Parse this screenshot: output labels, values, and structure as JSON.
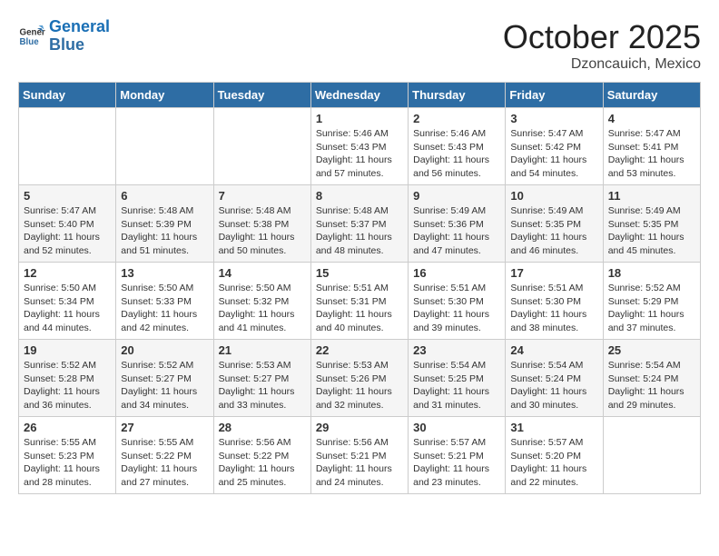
{
  "header": {
    "logo_line1": "General",
    "logo_line2": "Blue",
    "month": "October 2025",
    "location": "Dzoncauich, Mexico"
  },
  "weekdays": [
    "Sunday",
    "Monday",
    "Tuesday",
    "Wednesday",
    "Thursday",
    "Friday",
    "Saturday"
  ],
  "weeks": [
    [
      {
        "day": "",
        "sunrise": "",
        "sunset": "",
        "daylight": ""
      },
      {
        "day": "",
        "sunrise": "",
        "sunset": "",
        "daylight": ""
      },
      {
        "day": "",
        "sunrise": "",
        "sunset": "",
        "daylight": ""
      },
      {
        "day": "1",
        "sunrise": "Sunrise: 5:46 AM",
        "sunset": "Sunset: 5:43 PM",
        "daylight": "Daylight: 11 hours and 57 minutes."
      },
      {
        "day": "2",
        "sunrise": "Sunrise: 5:46 AM",
        "sunset": "Sunset: 5:43 PM",
        "daylight": "Daylight: 11 hours and 56 minutes."
      },
      {
        "day": "3",
        "sunrise": "Sunrise: 5:47 AM",
        "sunset": "Sunset: 5:42 PM",
        "daylight": "Daylight: 11 hours and 54 minutes."
      },
      {
        "day": "4",
        "sunrise": "Sunrise: 5:47 AM",
        "sunset": "Sunset: 5:41 PM",
        "daylight": "Daylight: 11 hours and 53 minutes."
      }
    ],
    [
      {
        "day": "5",
        "sunrise": "Sunrise: 5:47 AM",
        "sunset": "Sunset: 5:40 PM",
        "daylight": "Daylight: 11 hours and 52 minutes."
      },
      {
        "day": "6",
        "sunrise": "Sunrise: 5:48 AM",
        "sunset": "Sunset: 5:39 PM",
        "daylight": "Daylight: 11 hours and 51 minutes."
      },
      {
        "day": "7",
        "sunrise": "Sunrise: 5:48 AM",
        "sunset": "Sunset: 5:38 PM",
        "daylight": "Daylight: 11 hours and 50 minutes."
      },
      {
        "day": "8",
        "sunrise": "Sunrise: 5:48 AM",
        "sunset": "Sunset: 5:37 PM",
        "daylight": "Daylight: 11 hours and 48 minutes."
      },
      {
        "day": "9",
        "sunrise": "Sunrise: 5:49 AM",
        "sunset": "Sunset: 5:36 PM",
        "daylight": "Daylight: 11 hours and 47 minutes."
      },
      {
        "day": "10",
        "sunrise": "Sunrise: 5:49 AM",
        "sunset": "Sunset: 5:35 PM",
        "daylight": "Daylight: 11 hours and 46 minutes."
      },
      {
        "day": "11",
        "sunrise": "Sunrise: 5:49 AM",
        "sunset": "Sunset: 5:35 PM",
        "daylight": "Daylight: 11 hours and 45 minutes."
      }
    ],
    [
      {
        "day": "12",
        "sunrise": "Sunrise: 5:50 AM",
        "sunset": "Sunset: 5:34 PM",
        "daylight": "Daylight: 11 hours and 44 minutes."
      },
      {
        "day": "13",
        "sunrise": "Sunrise: 5:50 AM",
        "sunset": "Sunset: 5:33 PM",
        "daylight": "Daylight: 11 hours and 42 minutes."
      },
      {
        "day": "14",
        "sunrise": "Sunrise: 5:50 AM",
        "sunset": "Sunset: 5:32 PM",
        "daylight": "Daylight: 11 hours and 41 minutes."
      },
      {
        "day": "15",
        "sunrise": "Sunrise: 5:51 AM",
        "sunset": "Sunset: 5:31 PM",
        "daylight": "Daylight: 11 hours and 40 minutes."
      },
      {
        "day": "16",
        "sunrise": "Sunrise: 5:51 AM",
        "sunset": "Sunset: 5:30 PM",
        "daylight": "Daylight: 11 hours and 39 minutes."
      },
      {
        "day": "17",
        "sunrise": "Sunrise: 5:51 AM",
        "sunset": "Sunset: 5:30 PM",
        "daylight": "Daylight: 11 hours and 38 minutes."
      },
      {
        "day": "18",
        "sunrise": "Sunrise: 5:52 AM",
        "sunset": "Sunset: 5:29 PM",
        "daylight": "Daylight: 11 hours and 37 minutes."
      }
    ],
    [
      {
        "day": "19",
        "sunrise": "Sunrise: 5:52 AM",
        "sunset": "Sunset: 5:28 PM",
        "daylight": "Daylight: 11 hours and 36 minutes."
      },
      {
        "day": "20",
        "sunrise": "Sunrise: 5:52 AM",
        "sunset": "Sunset: 5:27 PM",
        "daylight": "Daylight: 11 hours and 34 minutes."
      },
      {
        "day": "21",
        "sunrise": "Sunrise: 5:53 AM",
        "sunset": "Sunset: 5:27 PM",
        "daylight": "Daylight: 11 hours and 33 minutes."
      },
      {
        "day": "22",
        "sunrise": "Sunrise: 5:53 AM",
        "sunset": "Sunset: 5:26 PM",
        "daylight": "Daylight: 11 hours and 32 minutes."
      },
      {
        "day": "23",
        "sunrise": "Sunrise: 5:54 AM",
        "sunset": "Sunset: 5:25 PM",
        "daylight": "Daylight: 11 hours and 31 minutes."
      },
      {
        "day": "24",
        "sunrise": "Sunrise: 5:54 AM",
        "sunset": "Sunset: 5:24 PM",
        "daylight": "Daylight: 11 hours and 30 minutes."
      },
      {
        "day": "25",
        "sunrise": "Sunrise: 5:54 AM",
        "sunset": "Sunset: 5:24 PM",
        "daylight": "Daylight: 11 hours and 29 minutes."
      }
    ],
    [
      {
        "day": "26",
        "sunrise": "Sunrise: 5:55 AM",
        "sunset": "Sunset: 5:23 PM",
        "daylight": "Daylight: 11 hours and 28 minutes."
      },
      {
        "day": "27",
        "sunrise": "Sunrise: 5:55 AM",
        "sunset": "Sunset: 5:22 PM",
        "daylight": "Daylight: 11 hours and 27 minutes."
      },
      {
        "day": "28",
        "sunrise": "Sunrise: 5:56 AM",
        "sunset": "Sunset: 5:22 PM",
        "daylight": "Daylight: 11 hours and 25 minutes."
      },
      {
        "day": "29",
        "sunrise": "Sunrise: 5:56 AM",
        "sunset": "Sunset: 5:21 PM",
        "daylight": "Daylight: 11 hours and 24 minutes."
      },
      {
        "day": "30",
        "sunrise": "Sunrise: 5:57 AM",
        "sunset": "Sunset: 5:21 PM",
        "daylight": "Daylight: 11 hours and 23 minutes."
      },
      {
        "day": "31",
        "sunrise": "Sunrise: 5:57 AM",
        "sunset": "Sunset: 5:20 PM",
        "daylight": "Daylight: 11 hours and 22 minutes."
      },
      {
        "day": "",
        "sunrise": "",
        "sunset": "",
        "daylight": ""
      }
    ]
  ]
}
